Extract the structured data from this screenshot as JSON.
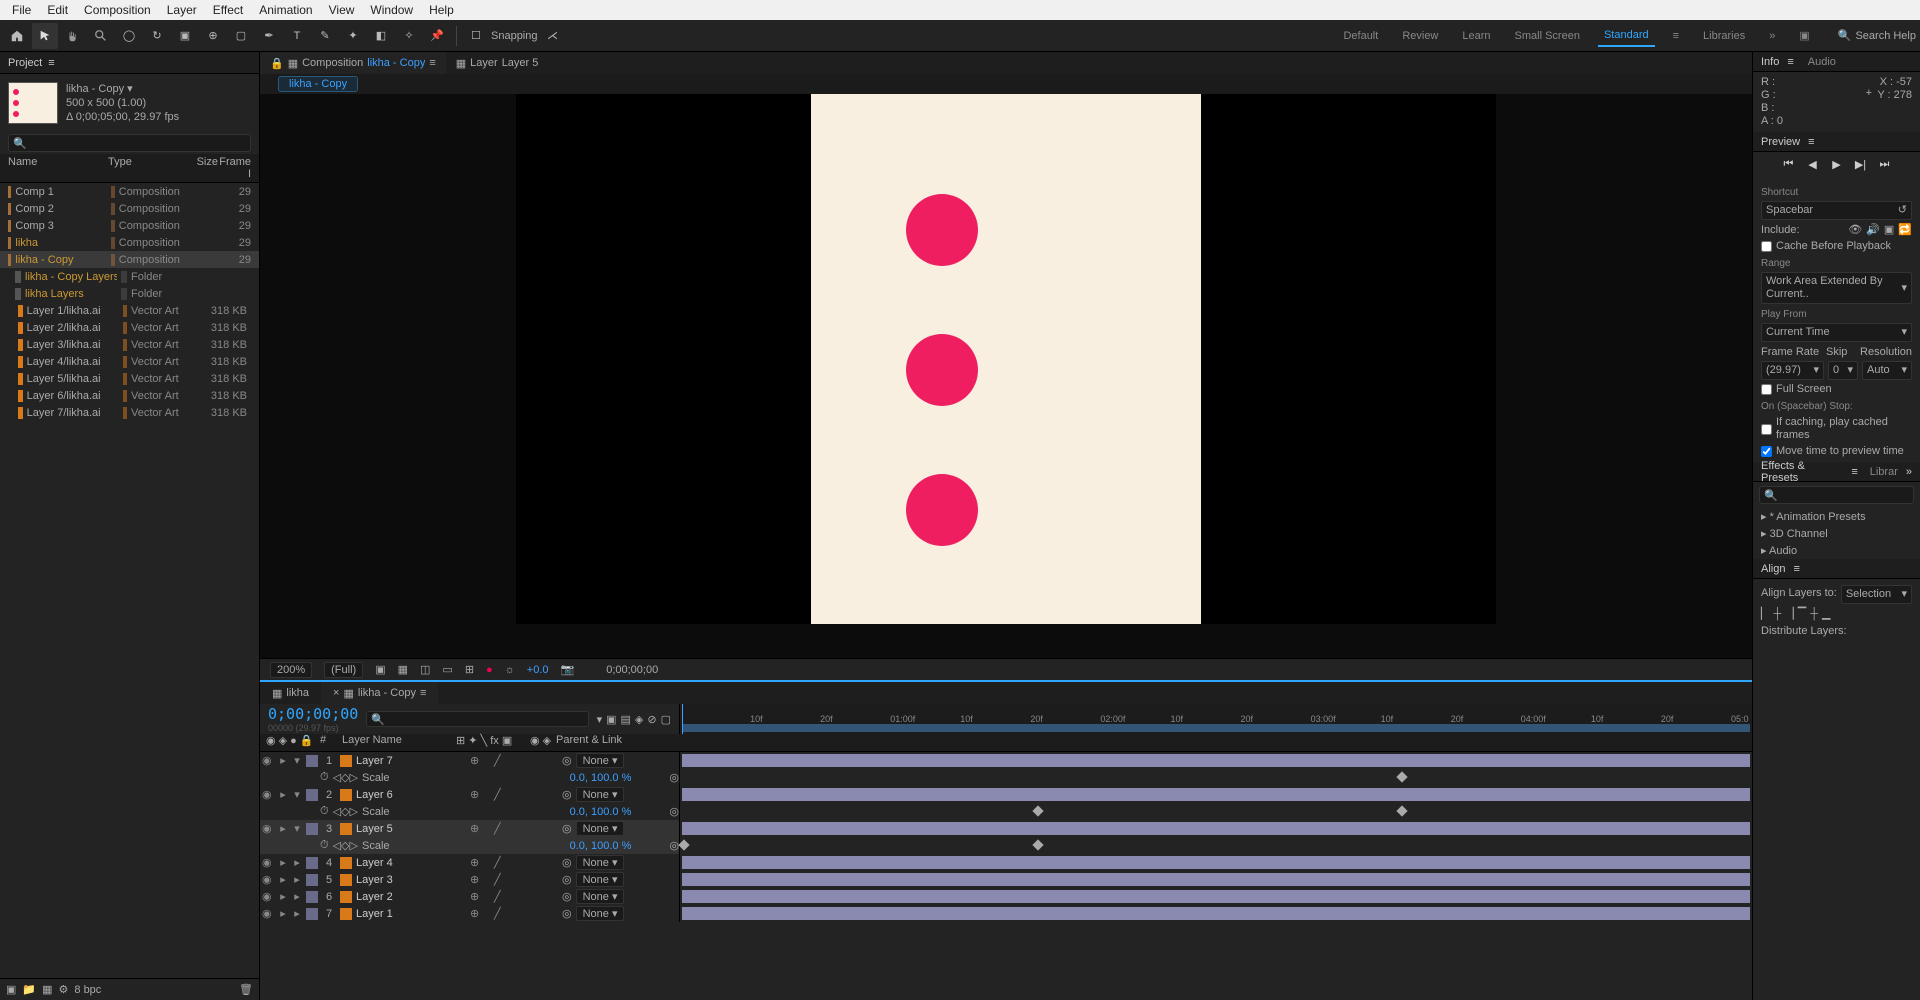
{
  "menu": [
    "File",
    "Edit",
    "Composition",
    "Layer",
    "Effect",
    "Animation",
    "View",
    "Window",
    "Help"
  ],
  "toolbar": {
    "snapping": "Snapping",
    "workspaces": [
      "Default",
      "Review",
      "Learn",
      "Small Screen",
      "Standard",
      "Libraries"
    ],
    "active_ws": "Standard",
    "search_placeholder": "Search Help"
  },
  "project": {
    "tab": "Project",
    "title": "likha - Copy ▾",
    "dim": "500 x 500 (1.00)",
    "dur": "Δ 0;00;05;00, 29.97 fps",
    "headers": [
      "Name",
      "Type",
      "Size",
      "Frame I"
    ],
    "items": [
      {
        "name": "Comp 1",
        "type": "Composition",
        "size": "",
        "frame": "29",
        "ico": "comp"
      },
      {
        "name": "Comp 2",
        "type": "Composition",
        "size": "",
        "frame": "29",
        "ico": "comp"
      },
      {
        "name": "Comp 3",
        "type": "Composition",
        "size": "",
        "frame": "29",
        "ico": "comp"
      },
      {
        "name": "likha",
        "type": "Composition",
        "size": "",
        "frame": "29",
        "ico": "comp",
        "folder": true
      },
      {
        "name": "likha - Copy",
        "type": "Composition",
        "size": "",
        "frame": "29",
        "ico": "comp",
        "folder": true,
        "sel": true
      },
      {
        "name": "likha - Copy Layers",
        "type": "Folder",
        "size": "",
        "frame": "",
        "ico": "fold",
        "folder": true,
        "indent": 1
      },
      {
        "name": "likha Layers",
        "type": "Folder",
        "size": "",
        "frame": "",
        "ico": "fold",
        "folder": true,
        "indent": 1
      },
      {
        "name": "Layer 1/likha.ai",
        "type": "Vector Art",
        "size": "318 KB",
        "frame": "",
        "ico": "ai",
        "indent": 2
      },
      {
        "name": "Layer 2/likha.ai",
        "type": "Vector Art",
        "size": "318 KB",
        "frame": "",
        "ico": "ai",
        "indent": 2
      },
      {
        "name": "Layer 3/likha.ai",
        "type": "Vector Art",
        "size": "318 KB",
        "frame": "",
        "ico": "ai",
        "indent": 2
      },
      {
        "name": "Layer 4/likha.ai",
        "type": "Vector Art",
        "size": "318 KB",
        "frame": "",
        "ico": "ai",
        "indent": 2
      },
      {
        "name": "Layer 5/likha.ai",
        "type": "Vector Art",
        "size": "318 KB",
        "frame": "",
        "ico": "ai",
        "indent": 2
      },
      {
        "name": "Layer 6/likha.ai",
        "type": "Vector Art",
        "size": "318 KB",
        "frame": "",
        "ico": "ai",
        "indent": 2
      },
      {
        "name": "Layer 7/likha.ai",
        "type": "Vector Art",
        "size": "318 KB",
        "frame": "",
        "ico": "ai",
        "indent": 2
      }
    ],
    "footer_bpc": "8 bpc"
  },
  "viewer": {
    "tabs": [
      {
        "pre": "Composition",
        "name": "likha - Copy",
        "active": true
      },
      {
        "pre": "Layer",
        "name": "Layer 5"
      }
    ],
    "flow": "likha - Copy",
    "zoom": "200%",
    "res": "(Full)",
    "exp": "+0.0",
    "time": "0;00;00;00"
  },
  "timeline": {
    "tabs": [
      "likha",
      "likha - Copy"
    ],
    "active_tab": "likha - Copy",
    "timecode": "0;00;00;00",
    "fps_line": "00000 (29.97 fps)",
    "col_layer": "Layer Name",
    "col_parent": "Parent & Link",
    "ticks": [
      "10f",
      "20f",
      "01:00f",
      "10f",
      "20f",
      "02:00f",
      "10f",
      "20f",
      "03:00f",
      "10f",
      "20f",
      "04:00f",
      "10f",
      "20f",
      "05:0"
    ],
    "layers": [
      {
        "n": 1,
        "name": "Layer 7",
        "prop": "Scale",
        "val": "0.0, 100.0 %",
        "parent": "None",
        "keys": [
          67
        ]
      },
      {
        "n": 2,
        "name": "Layer 6",
        "prop": "Scale",
        "val": "0.0, 100.0 %",
        "parent": "None",
        "keys": [
          33,
          67
        ]
      },
      {
        "n": 3,
        "name": "Layer 5",
        "prop": "Scale",
        "val": "0.0, 100.0 %",
        "parent": "None",
        "sel": true,
        "keys": [
          0,
          33
        ]
      },
      {
        "n": 4,
        "name": "Layer 4",
        "parent": "None"
      },
      {
        "n": 5,
        "name": "Layer 3",
        "parent": "None"
      },
      {
        "n": 6,
        "name": "Layer 2",
        "parent": "None"
      },
      {
        "n": 7,
        "name": "Layer 1",
        "parent": "None"
      }
    ]
  },
  "info": {
    "tab": "Info",
    "audio_tab": "Audio",
    "R": "R :",
    "G": "G :",
    "B": "B :",
    "A": "A :",
    "Aval": "0",
    "X": "X :",
    "Xval": "-57",
    "Y": "Y :",
    "Yval": "278"
  },
  "preview": {
    "tab": "Preview",
    "shortcut": "Shortcut",
    "spacebar": "Spacebar",
    "include": "Include:",
    "cache": "Cache Before Playback",
    "range": "Range",
    "range_val": "Work Area Extended By Current..",
    "playfrom": "Play From",
    "playfrom_val": "Current Time",
    "fr": "Frame Rate",
    "skip": "Skip",
    "res": "Resolution",
    "fr_val": "(29.97)",
    "skip_val": "0",
    "res_val": "Auto",
    "full": "Full Screen",
    "onstop": "On (Spacebar) Stop:",
    "ifcache": "If caching, play cached frames",
    "movetime": "Move time to preview time"
  },
  "effects": {
    "tab": "Effects & Presets",
    "lib": "Librar",
    "items": [
      "* Animation Presets",
      "3D Channel",
      "Audio"
    ]
  },
  "align": {
    "tab": "Align",
    "alignto": "Align Layers to:",
    "dist": "Distribute Layers:"
  }
}
